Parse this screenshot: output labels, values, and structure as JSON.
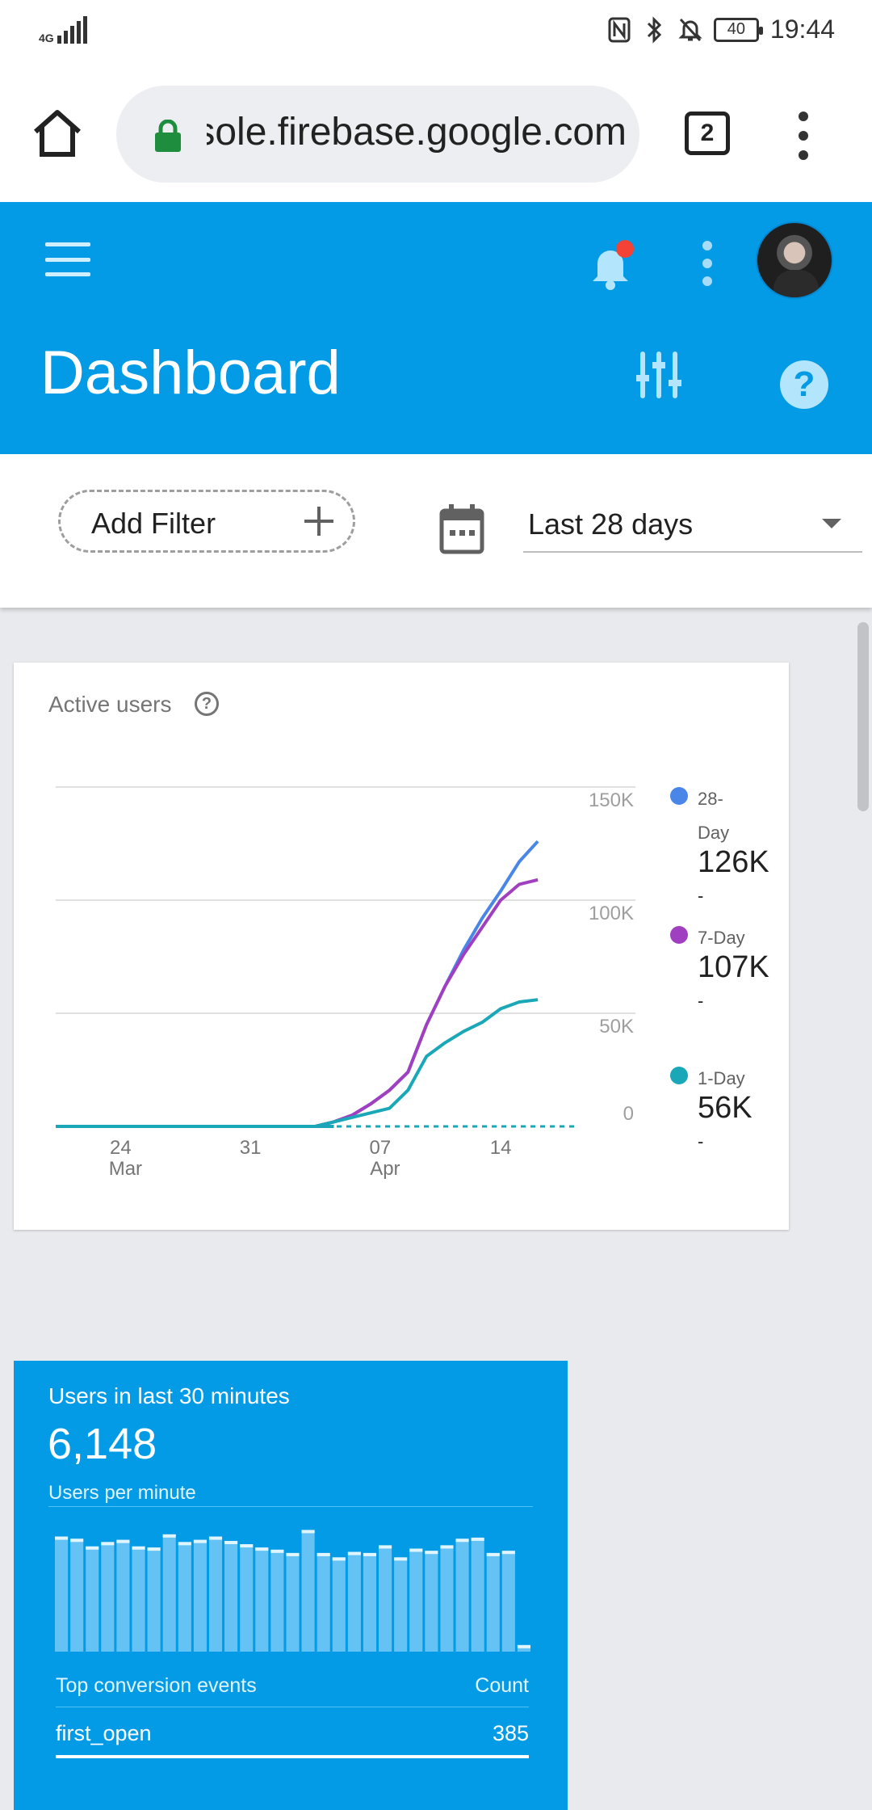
{
  "status_bar": {
    "network": "4G",
    "battery": "40",
    "time": "19:44",
    "icons": [
      "nfc-icon",
      "bluetooth-icon",
      "bell-off-icon"
    ]
  },
  "browser": {
    "url": "console.firebase.google.com",
    "tab_count": "2"
  },
  "header": {
    "title": "Dashboard",
    "accent_color": "#039be5"
  },
  "filters": {
    "add_filter_label": "Add Filter",
    "date_range": "Last 28 days"
  },
  "active_users": {
    "title": "Active users",
    "help_glyph": "?",
    "legend": [
      {
        "name": "28-Day",
        "value": "126K",
        "delta": "-",
        "color": "#4a86e8"
      },
      {
        "name": "7-Day",
        "value": "107K",
        "delta": "-",
        "color": "#a040c0"
      },
      {
        "name": "1-Day",
        "value": "56K",
        "delta": "-",
        "color": "#1aa8b8"
      }
    ]
  },
  "chart_data": {
    "type": "line",
    "title": "Active users",
    "x_ticks": [
      {
        "day": "24",
        "month": "Mar"
      },
      {
        "day": "31",
        "month": ""
      },
      {
        "day": "07",
        "month": "Apr"
      },
      {
        "day": "14",
        "month": ""
      }
    ],
    "y_ticks": [
      "150K",
      "100K",
      "50K",
      "0"
    ],
    "ylim": [
      0,
      150000
    ],
    "x_range": [
      0,
      28
    ],
    "series": [
      {
        "name": "28-Day",
        "color": "#4a86e8",
        "points": [
          [
            0,
            0
          ],
          [
            2,
            0
          ],
          [
            4,
            0
          ],
          [
            6,
            0
          ],
          [
            8,
            0
          ],
          [
            10,
            0
          ],
          [
            12,
            0
          ],
          [
            14,
            0
          ],
          [
            15,
            2000
          ],
          [
            16,
            5000
          ],
          [
            17,
            10000
          ],
          [
            18,
            16000
          ],
          [
            19,
            24000
          ],
          [
            20,
            45000
          ],
          [
            21,
            62000
          ],
          [
            22,
            78000
          ],
          [
            23,
            92000
          ],
          [
            24,
            104000
          ],
          [
            25,
            117000
          ],
          [
            26,
            126000
          ]
        ]
      },
      {
        "name": "7-Day",
        "color": "#a040c0",
        "points": [
          [
            0,
            0
          ],
          [
            2,
            0
          ],
          [
            4,
            0
          ],
          [
            6,
            0
          ],
          [
            8,
            0
          ],
          [
            10,
            0
          ],
          [
            12,
            0
          ],
          [
            14,
            0
          ],
          [
            15,
            2000
          ],
          [
            16,
            5000
          ],
          [
            17,
            10000
          ],
          [
            18,
            16000
          ],
          [
            19,
            24000
          ],
          [
            20,
            45000
          ],
          [
            21,
            62000
          ],
          [
            22,
            76000
          ],
          [
            23,
            88000
          ],
          [
            24,
            100000
          ],
          [
            25,
            107000
          ],
          [
            26,
            109000
          ]
        ]
      },
      {
        "name": "1-Day",
        "color": "#1aa8b8",
        "points": [
          [
            0,
            0
          ],
          [
            2,
            0
          ],
          [
            4,
            0
          ],
          [
            6,
            0
          ],
          [
            8,
            0
          ],
          [
            10,
            0
          ],
          [
            12,
            0
          ],
          [
            14,
            0
          ],
          [
            15,
            2000
          ],
          [
            16,
            4000
          ],
          [
            17,
            6000
          ],
          [
            18,
            8000
          ],
          [
            19,
            16000
          ],
          [
            20,
            31000
          ],
          [
            21,
            37000
          ],
          [
            22,
            42000
          ],
          [
            23,
            46000
          ],
          [
            24,
            52000
          ],
          [
            25,
            55000
          ],
          [
            26,
            56000
          ]
        ]
      }
    ]
  },
  "realtime": {
    "title": "Users in last 30 minutes",
    "count": "6,148",
    "subtitle": "Users per minute",
    "bars": [
      210,
      206,
      192,
      200,
      204,
      192,
      190,
      214,
      200,
      204,
      210,
      202,
      196,
      190,
      186,
      180,
      222,
      180,
      172,
      182,
      180,
      194,
      172,
      188,
      184,
      194,
      206,
      208,
      180,
      184,
      12
    ],
    "table_header_left": "Top conversion events",
    "table_header_right": "Count",
    "rows": [
      {
        "event": "first_open",
        "count": "385"
      }
    ]
  }
}
